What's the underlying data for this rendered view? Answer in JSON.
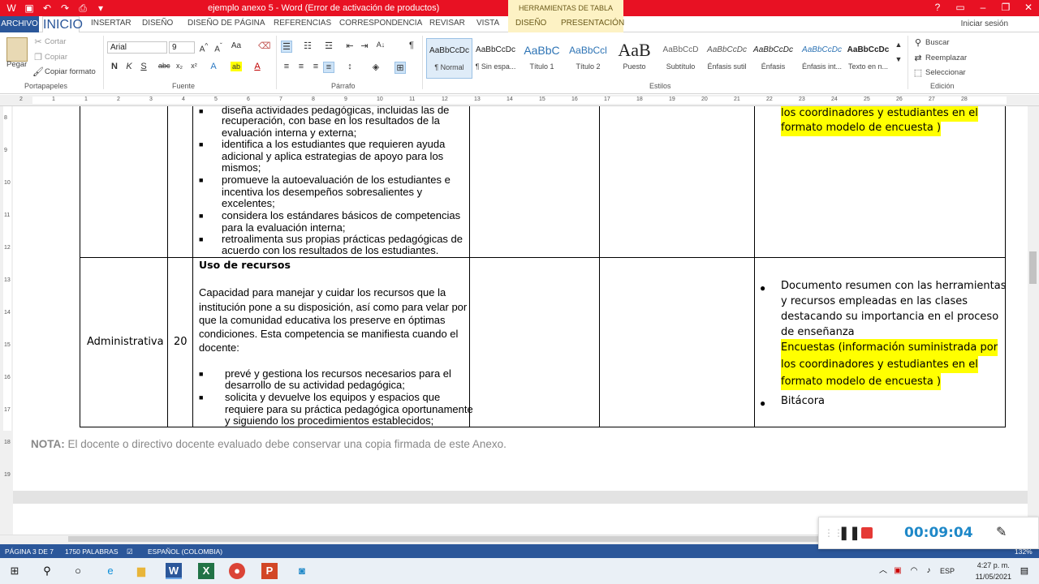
{
  "window": {
    "title": "ejemplo anexo 5 -  Word (Error de activación de productos)",
    "tools_group": "HERRAMIENTAS DE TABLA",
    "signin": "Iniciar sesión"
  },
  "tabs": [
    "ARCHIVO",
    "INICIO",
    "INSERTAR",
    "DISEÑO",
    "DISEÑO DE PÁGINA",
    "REFERENCIAS",
    "CORRESPONDENCIA",
    "REVISAR",
    "VISTA",
    "DISEÑO",
    "PRESENTACIÓN"
  ],
  "ribbon": {
    "clipboard": {
      "paste": "Pegar",
      "cut": "Cortar",
      "copy": "Copiar",
      "format_painter": "Copiar formato",
      "label": "Portapapeles"
    },
    "font": {
      "name": "Arial",
      "size": "9",
      "label": "Fuente"
    },
    "paragraph": {
      "label": "Párrafo"
    },
    "styles": {
      "label": "Estilos",
      "items": [
        {
          "preview": "AaBbCcDc",
          "name": "¶ Normal"
        },
        {
          "preview": "AaBbCcDc",
          "name": "¶ Sin espa..."
        },
        {
          "preview": "AaBbC",
          "name": "Título 1"
        },
        {
          "preview": "AaBbCcl",
          "name": "Título 2"
        },
        {
          "preview": "AaB",
          "name": "Puesto"
        },
        {
          "preview": "AaBbCcD",
          "name": "Subtítulo"
        },
        {
          "preview": "AaBbCcDc",
          "name": "Énfasis sutil"
        },
        {
          "preview": "AaBbCcDc",
          "name": "Énfasis"
        },
        {
          "preview": "AaBbCcDc",
          "name": "Énfasis int..."
        },
        {
          "preview": "AaBbCcDc",
          "name": "Texto en n..."
        }
      ]
    },
    "editing": {
      "find": "Buscar",
      "replace": "Reemplazar",
      "select": "Seleccionar",
      "label": "Edición"
    }
  },
  "ruler": {
    "h_numbers": [
      "2",
      "1",
      "1",
      "2",
      "3",
      "4",
      "5",
      "6",
      "7",
      "8",
      "9",
      "10",
      "11",
      "12",
      "13",
      "14",
      "15",
      "16",
      "17",
      "18",
      "19",
      "20",
      "21",
      "22",
      "23",
      "24",
      "25",
      "26",
      "27",
      "28"
    ],
    "v_numbers": [
      "8",
      "9",
      "10",
      "11",
      "12",
      "13",
      "14",
      "15",
      "16",
      "17",
      "18",
      "19"
    ]
  },
  "document": {
    "row1": {
      "bullets": [
        {
          "lines": [
            "diseña actividades pedagógicas, incluidas las de",
            "recuperación, con base en los resultados de la",
            "evaluación interna y externa;"
          ]
        },
        {
          "lines": [
            "identifica a los estudiantes que requieren ayuda",
            "adicional y aplica estrategias de apoyo para los",
            "mismos;"
          ]
        },
        {
          "lines": [
            "promueve la autoevaluación de los estudiantes e",
            "incentiva los desempeños sobresalientes y",
            "excelentes;"
          ]
        },
        {
          "lines": [
            "considera los estándares básicos de competencias",
            "para la evaluación interna;"
          ]
        },
        {
          "lines": [
            "retroalimenta sus propias prácticas pedagógicas de",
            "acuerdo con los resultados de los estudiantes."
          ]
        }
      ],
      "evidence": [
        "los coordinadores y estudiantes en el",
        "formato modelo de encuesta )"
      ]
    },
    "row2": {
      "area": "Administrativa",
      "weight": "20",
      "heading": "Uso de recursos",
      "paragraph": [
        "Capacidad para manejar y cuidar los recursos que la",
        "institución pone a su disposición, así como para velar por",
        "que la comunidad educativa los preserve en óptimas",
        "condiciones. Esta competencia se manifiesta cuando el",
        "docente:"
      ],
      "bullets": [
        {
          "lines": [
            "prevé y gestiona los recursos necesarios para el",
            "desarrollo de su actividad pedagógica;"
          ]
        },
        {
          "lines": [
            "solicita y devuelve los equipos y espacios que",
            "requiere para su práctica pedagógica oportunamente",
            "y siguiendo los procedimientos establecidos;"
          ]
        }
      ],
      "evidence_bullet1": [
        "Documento resumen con las herramientas",
        "y recursos empleadas en las clases",
        "destacando su importancia en el proceso",
        "de enseñanza"
      ],
      "evidence_highlight": [
        "Encuestas (información suministrada por",
        "los coordinadores y estudiantes en el",
        "formato modelo de encuesta )"
      ],
      "evidence_bullet2": "Bitácora"
    },
    "note_label": "NOTA:",
    "note_text": " El docente o directivo docente evaluado debe conservar una copia firmada de este Anexo."
  },
  "status": {
    "page": "PÁGINA 3 DE 7",
    "words": "1750 PALABRAS",
    "language": "ESPAÑOL (COLOMBIA)",
    "zoom": "132%"
  },
  "recorder": {
    "time": "00:09:04"
  },
  "taskbar": {
    "lang": "ESP",
    "time": "4:27 p. m.",
    "date": "11/05/2021"
  },
  "colors": {
    "title_red": "#e81123",
    "word_blue": "#2b579a",
    "highlight": "#ffff00"
  }
}
